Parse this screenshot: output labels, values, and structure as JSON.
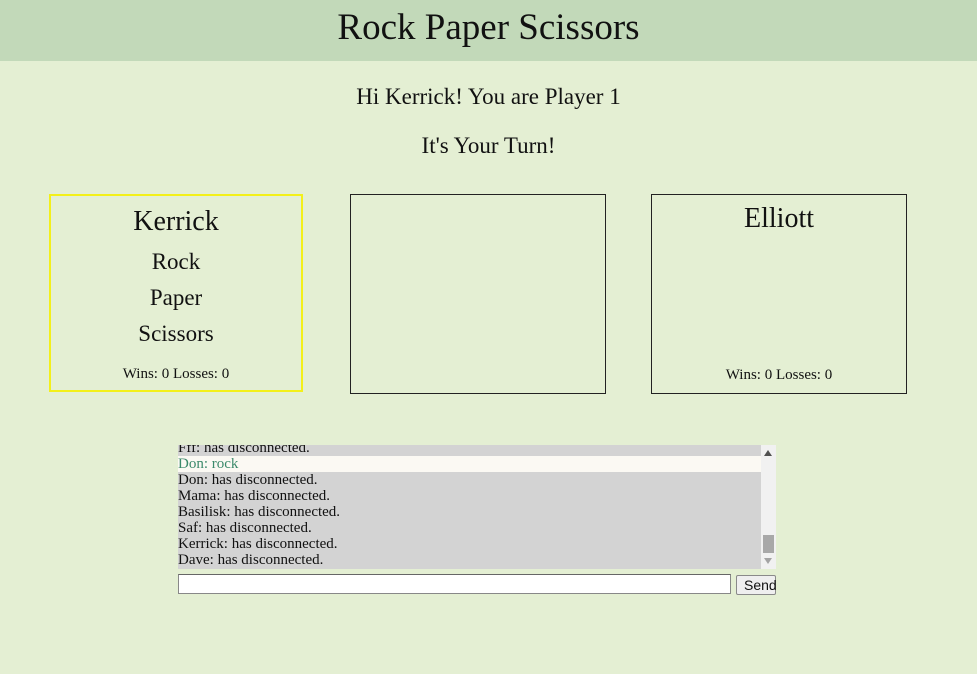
{
  "header": {
    "title": "Rock Paper Scissors"
  },
  "status": {
    "greeting": "Hi Kerrick! You are Player 1",
    "turn": "It's Your Turn!"
  },
  "player1": {
    "name": "Kerrick",
    "choices": [
      "Rock",
      "Paper",
      "Scissors"
    ],
    "record": "Wins: 0 Losses: 0"
  },
  "player2": {
    "name": "Elliott",
    "record": "Wins: 0 Losses: 0"
  },
  "chat": {
    "messages": [
      "Fff: has disconnected.",
      "Don: rock",
      "Don: has disconnected.",
      "Mama: has disconnected.",
      "Basilisk: has disconnected.",
      "Saf: has disconnected.",
      "Kerrick: has disconnected.",
      "Dave: has disconnected."
    ],
    "input_value": "",
    "send_label": "Send"
  },
  "colors": {
    "background": "#e4efd3",
    "header": "#c2d9b9",
    "active_border": "#f3f019",
    "highlight_text": "#3c8a6b"
  }
}
